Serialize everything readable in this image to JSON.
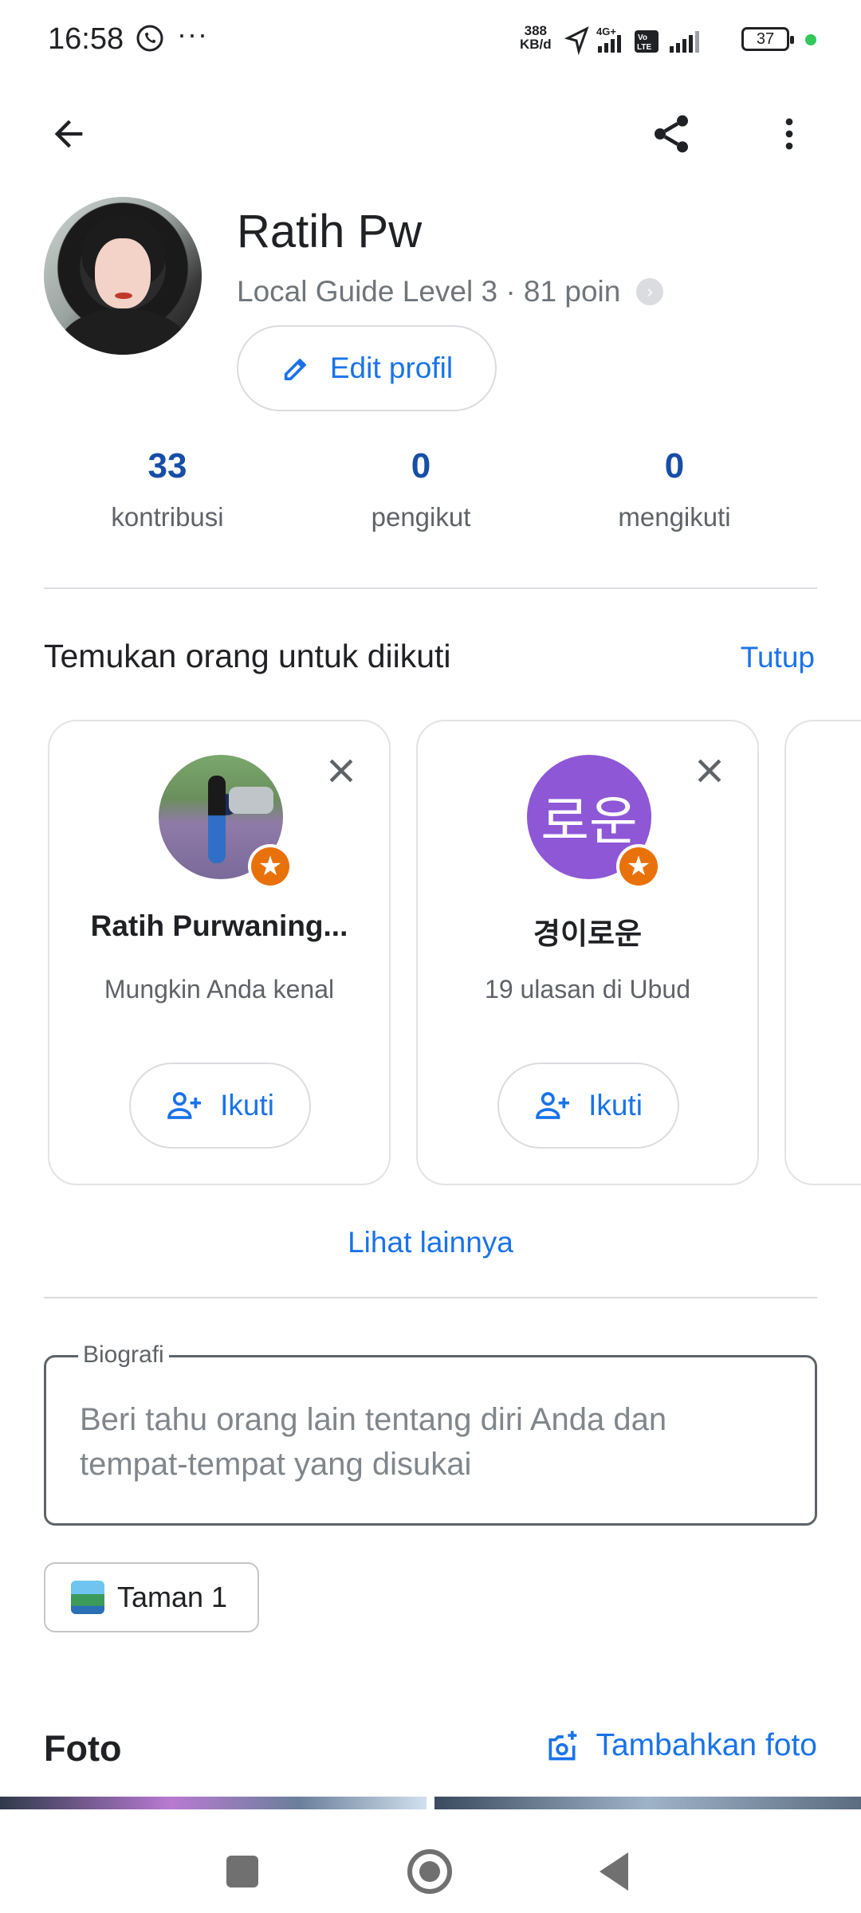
{
  "status_bar": {
    "time": "16:58",
    "more": "···",
    "net_speed_value": "388",
    "net_speed_unit": "KB/d",
    "battery": "37",
    "icons": [
      "whatsapp-icon",
      "location-arrow-icon",
      "4g-signal-icon",
      "volte-icon",
      "signal-icon",
      "battery-icon"
    ]
  },
  "app_bar": {
    "icons": [
      "back-arrow-icon",
      "share-icon",
      "more-vert-icon"
    ]
  },
  "profile": {
    "name": "Ratih Pw",
    "level_text": "Local Guide Level 3 · 81 poin",
    "edit_label": "Edit profil"
  },
  "stats": [
    {
      "value": "33",
      "label": "kontribusi"
    },
    {
      "value": "0",
      "label": "pengikut"
    },
    {
      "value": "0",
      "label": "mengikuti"
    }
  ],
  "suggestions": {
    "title": "Temukan orang untuk diikuti",
    "close_label": "Tutup",
    "cards": [
      {
        "name": "Ratih Purwaning...",
        "subtitle": "Mungkin Anda kenal",
        "follow_label": "Ikuti"
      },
      {
        "name": "경이로운",
        "avatar_text": "로운",
        "subtitle": "19 ulasan di Ubud",
        "follow_label": "Ikuti"
      }
    ],
    "see_more": "Lihat lainnya"
  },
  "bio": {
    "label": "Biografi",
    "placeholder": "Beri tahu orang lain tentang diri Anda dan tempat-tempat yang disukai"
  },
  "chip": {
    "label": "Taman 1"
  },
  "photos": {
    "title": "Foto",
    "add_label": "Tambahkan foto"
  },
  "colors": {
    "accent": "#1a73e8",
    "stat_number": "#174ea6",
    "badge": "#e8710a",
    "avatar_purple": "#8e57d6"
  }
}
